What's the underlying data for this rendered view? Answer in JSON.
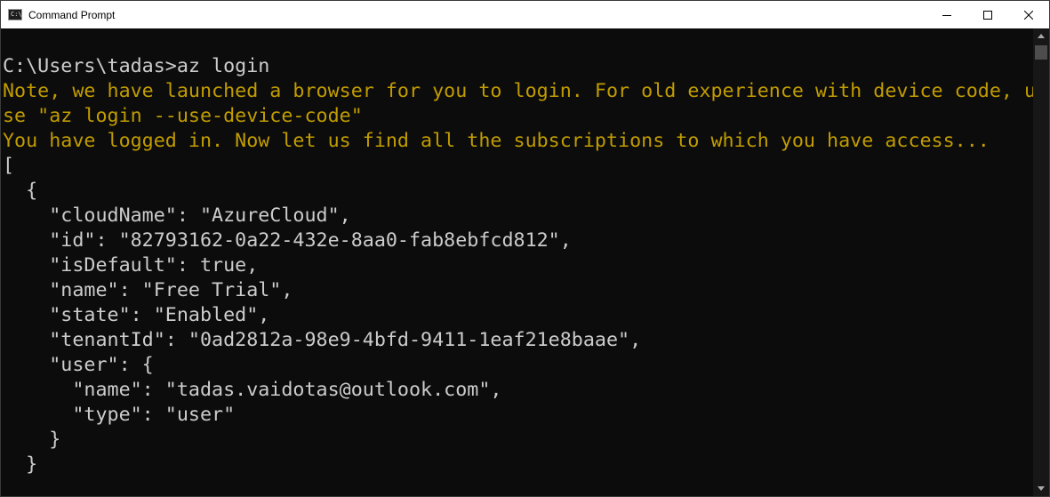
{
  "window": {
    "title": "Command Prompt",
    "app_icon_text": "C:\\",
    "controls": {
      "minimize_icon": "minimize-icon",
      "maximize_icon": "maximize-icon",
      "close_icon": "close-icon"
    }
  },
  "terminal": {
    "colors": {
      "background": "#0c0c0c",
      "text": "#cccccc",
      "warning": "#c19c00"
    },
    "lines": [
      {
        "text": "C:\\Users\\tadas>az login",
        "color": "white"
      },
      {
        "text": "Note, we have launched a browser for you to login. For old experience with device code, u",
        "color": "yellow"
      },
      {
        "text": "se \"az login --use-device-code\"",
        "color": "yellow"
      },
      {
        "text": "You have logged in. Now let us find all the subscriptions to which you have access...",
        "color": "yellow"
      },
      {
        "text": "[",
        "color": "white"
      },
      {
        "text": "  {",
        "color": "white"
      },
      {
        "text": "    \"cloudName\": \"AzureCloud\",",
        "color": "white"
      },
      {
        "text": "    \"id\": \"82793162-0a22-432e-8aa0-fab8ebfcd812\",",
        "color": "white"
      },
      {
        "text": "    \"isDefault\": true,",
        "color": "white"
      },
      {
        "text": "    \"name\": \"Free Trial\",",
        "color": "white"
      },
      {
        "text": "    \"state\": \"Enabled\",",
        "color": "white"
      },
      {
        "text": "    \"tenantId\": \"0ad2812a-98e9-4bfd-9411-1eaf21e8baae\",",
        "color": "white"
      },
      {
        "text": "    \"user\": {",
        "color": "white"
      },
      {
        "text": "      \"name\": \"tadas.vaidotas@outlook.com\",",
        "color": "white"
      },
      {
        "text": "      \"type\": \"user\"",
        "color": "white"
      },
      {
        "text": "    }",
        "color": "white"
      },
      {
        "text": "  }",
        "color": "white"
      }
    ]
  }
}
